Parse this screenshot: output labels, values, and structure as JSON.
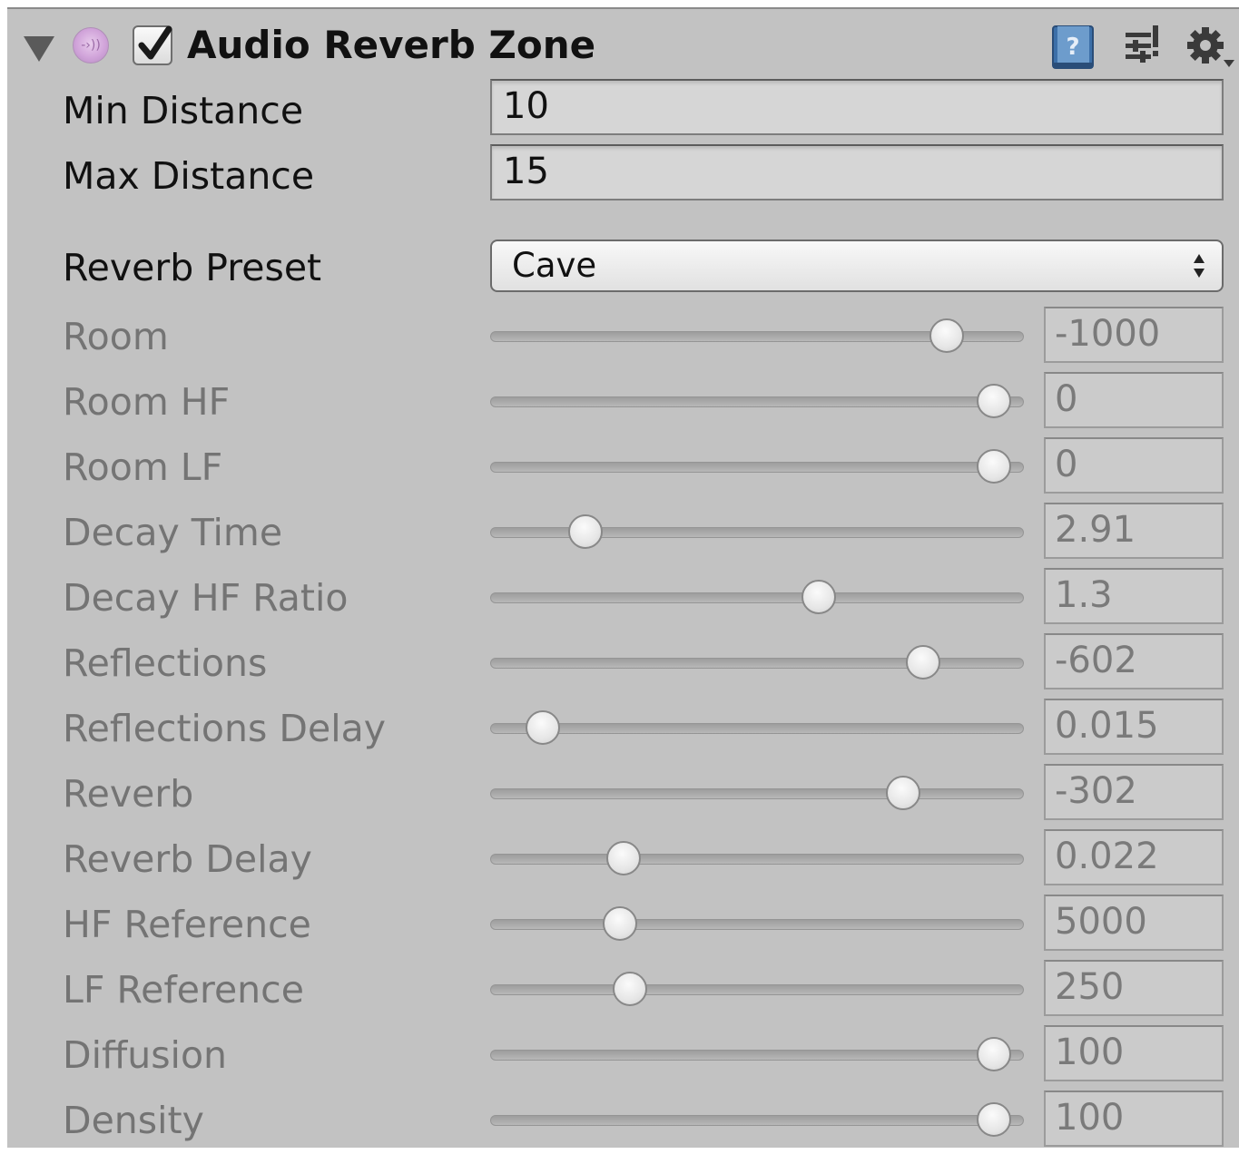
{
  "header": {
    "title": "Audio Reverb Zone",
    "enabled": true,
    "icons": [
      "foldout-arrow-icon",
      "audio-reverb-zone-icon",
      "help-book-icon",
      "presets-icon",
      "gear-icon"
    ]
  },
  "fields": {
    "min_distance": {
      "label": "Min Distance",
      "value": "10"
    },
    "max_distance": {
      "label": "Max Distance",
      "value": "15"
    },
    "reverb_preset": {
      "label": "Reverb Preset",
      "value": "Cave"
    }
  },
  "sliders": [
    {
      "label": "Room",
      "value": "-1000",
      "fraction": 0.878
    },
    {
      "label": "Room HF",
      "value": "0",
      "fraction": 0.973
    },
    {
      "label": "Room LF",
      "value": "0",
      "fraction": 0.973
    },
    {
      "label": "Decay Time",
      "value": "2.91",
      "fraction": 0.158
    },
    {
      "label": "Decay HF Ratio",
      "value": "1.3",
      "fraction": 0.624
    },
    {
      "label": "Reflections",
      "value": "-602",
      "fraction": 0.832
    },
    {
      "label": "Reflections Delay",
      "value": "0.015",
      "fraction": 0.072
    },
    {
      "label": "Reverb",
      "value": "-302",
      "fraction": 0.792
    },
    {
      "label": "Reverb Delay",
      "value": "0.022",
      "fraction": 0.233
    },
    {
      "label": "HF Reference",
      "value": "5000",
      "fraction": 0.226
    },
    {
      "label": "LF Reference",
      "value": "250",
      "fraction": 0.246
    },
    {
      "label": "Diffusion",
      "value": "100",
      "fraction": 0.973
    },
    {
      "label": "Density",
      "value": "100",
      "fraction": 0.973
    }
  ]
}
